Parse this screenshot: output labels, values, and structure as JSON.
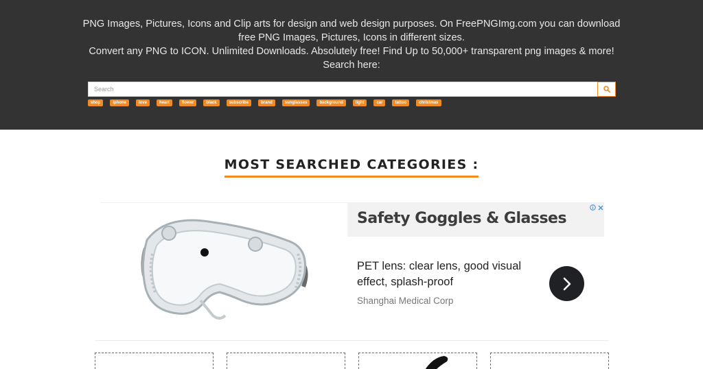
{
  "header": {
    "intro_line1": "PNG Images, Pictures, Icons and Clip arts for design and web design purposes. On FreePNGImg.com you can download free PNG Images, Pictures, Icons in different sizes.",
    "intro_line2": "Convert any PNG to ICON. Unlimited Downloads. Absolutely free! Find Up to 50,000+ transparent png images & more! Search here:"
  },
  "search": {
    "placeholder": "Search",
    "value": ""
  },
  "tags": [
    "shop",
    "iphone",
    "love",
    "heart",
    "flower",
    "black",
    "subscribe",
    "brand",
    "sunglasses",
    "background",
    "light",
    "car",
    "tattoo",
    "christmas"
  ],
  "categories": {
    "title": "MOST SEARCHED CATEGORIES :"
  },
  "ad": {
    "headline": "Safety Goggles & Glasses",
    "body": "PET lens: clear lens, good visual effect, splash-proof",
    "advertiser": "Shanghai Medical Corp"
  },
  "colors": {
    "header_bg": "#333333",
    "accent": "#f28a1e",
    "tag_bg": "#f08a24",
    "ad_arrow_bg": "#202124",
    "adchoices_blue": "#4a90d9"
  },
  "icons": {
    "search_button": "search-icon",
    "ad_arrow": "chevron-right-icon",
    "ad_info": "info-icon",
    "ad_close": "close-icon"
  }
}
